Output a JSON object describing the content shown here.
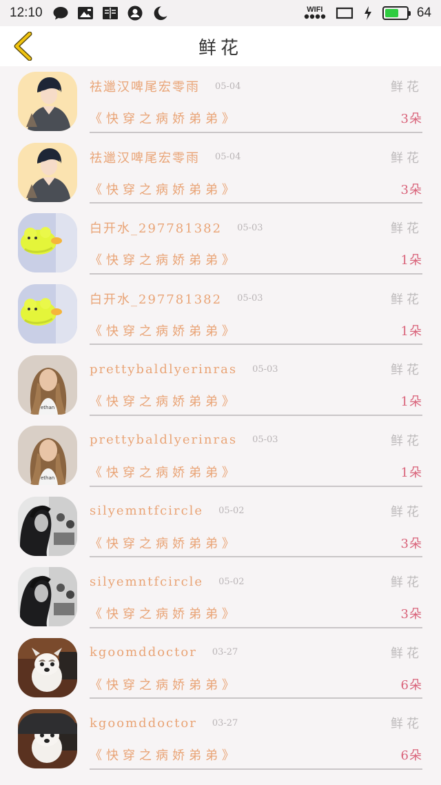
{
  "status_bar": {
    "time": "12:10",
    "wifi_label": "WIFI",
    "battery_percent": "64",
    "battery_level": 0.64,
    "icons": [
      "chat-bubble-icon",
      "image-icon",
      "book-icon",
      "account-icon",
      "moon-icon",
      "wifi-icon",
      "screen-icon",
      "charging-icon",
      "battery-icon"
    ]
  },
  "header": {
    "title": "鲜花",
    "back_icon": "chevron-left-icon",
    "accent_color": "#f1c40f"
  },
  "list": {
    "items": [
      {
        "user": "祛邋汉啤尾宏零雨",
        "date": "05-04",
        "gift_type": "鲜花",
        "book": "《快穿之病娇弟弟》",
        "count": "3朵",
        "avatar": "anime-boy"
      },
      {
        "user": "祛邋汉啤尾宏零雨",
        "date": "05-04",
        "gift_type": "鲜花",
        "book": "《快穿之病娇弟弟》",
        "count": "3朵",
        "avatar": "anime-boy"
      },
      {
        "user": "白开水_297781382",
        "date": "05-03",
        "gift_type": "鲜花",
        "book": "《快穿之病娇弟弟》",
        "count": "1朵",
        "avatar": "yellow-toy"
      },
      {
        "user": "白开水_297781382",
        "date": "05-03",
        "gift_type": "鲜花",
        "book": "《快穿之病娇弟弟》",
        "count": "1朵",
        "avatar": "yellow-toy"
      },
      {
        "user": "prettybaldlyerinras",
        "date": "05-03",
        "gift_type": "鲜花",
        "book": "《快穿之病娇弟弟》",
        "count": "1朵",
        "avatar": "woman-photo"
      },
      {
        "user": "prettybaldlyerinras",
        "date": "05-03",
        "gift_type": "鲜花",
        "book": "《快穿之病娇弟弟》",
        "count": "1朵",
        "avatar": "woman-photo"
      },
      {
        "user": "silyemntfcircle",
        "date": "05-02",
        "gift_type": "鲜花",
        "book": "《快穿之病娇弟弟》",
        "count": "3朵",
        "avatar": "bw-girl"
      },
      {
        "user": "silyemntfcircle",
        "date": "05-02",
        "gift_type": "鲜花",
        "book": "《快穿之病娇弟弟》",
        "count": "3朵",
        "avatar": "bw-girl"
      },
      {
        "user": "kgoomddoctor",
        "date": "03-27",
        "gift_type": "鲜花",
        "book": "《快穿之病娇弟弟》",
        "count": "6朵",
        "avatar": "puppy"
      },
      {
        "user": "kgoomddoctor",
        "date": "03-27",
        "gift_type": "鲜花",
        "book": "《快穿之病娇弟弟》",
        "count": "6朵",
        "avatar": "puppy"
      }
    ]
  },
  "colors": {
    "name_color": "#e9a476",
    "count_color": "#d9637a",
    "muted_color": "#bdbabb",
    "background": "#f7f4f5"
  }
}
